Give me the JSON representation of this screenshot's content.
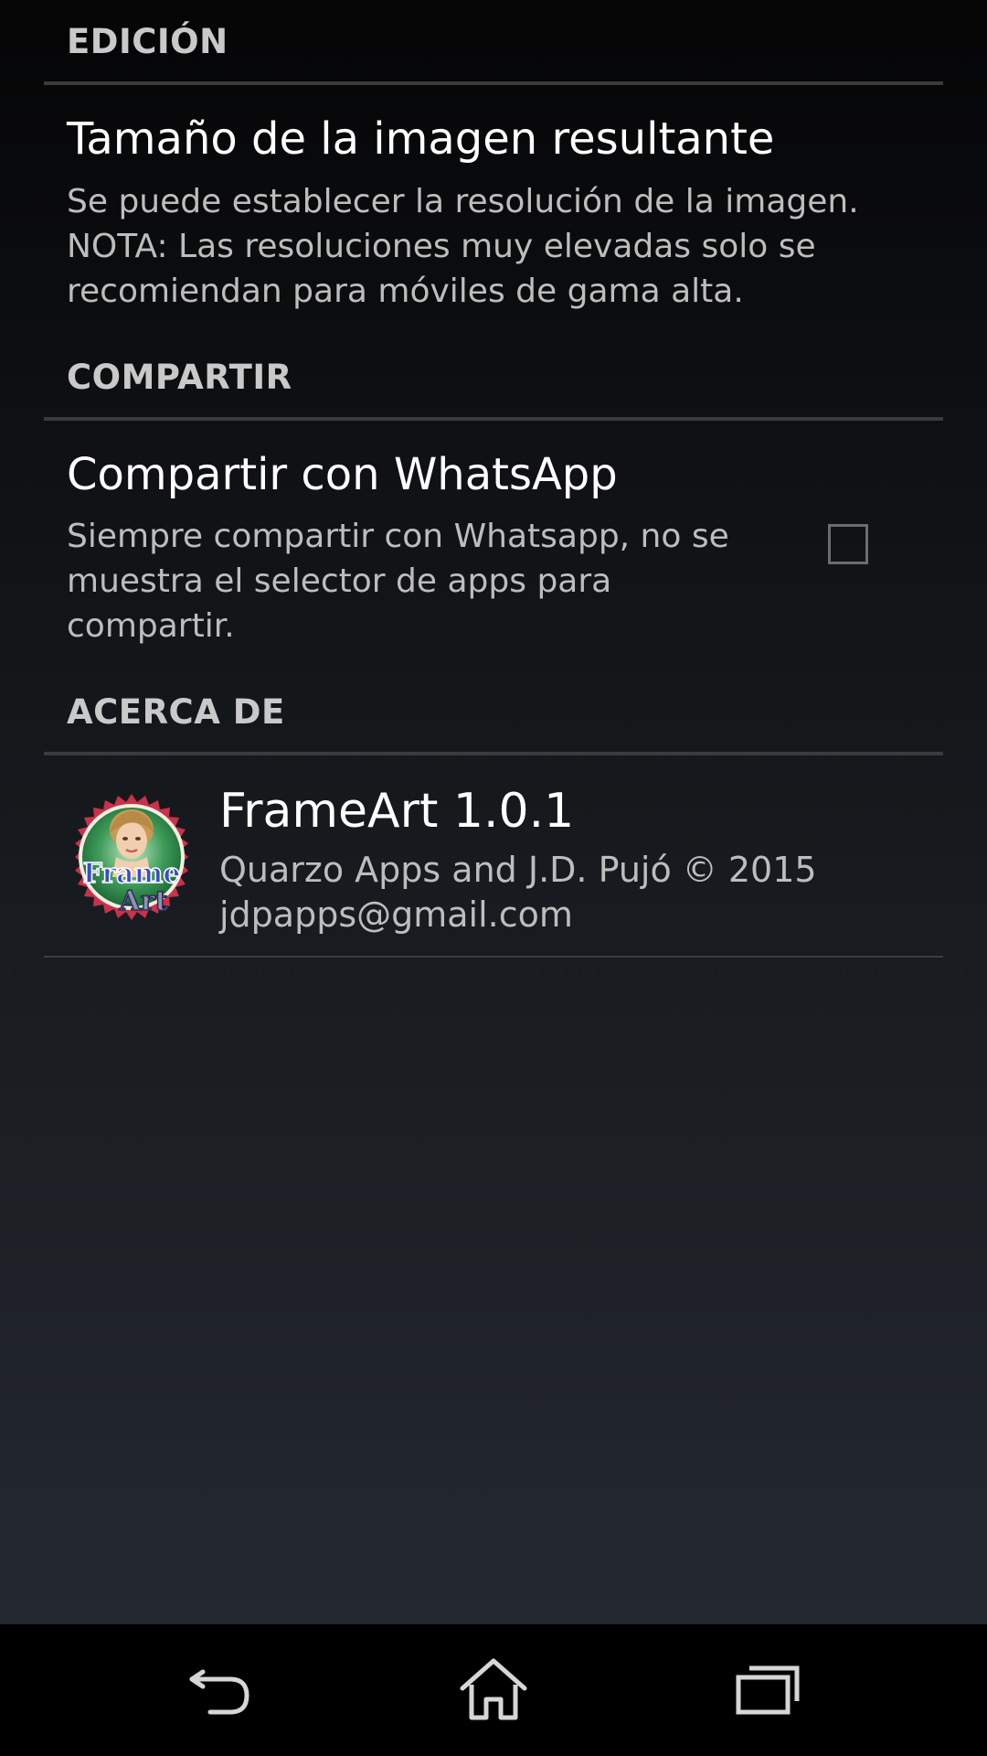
{
  "sections": {
    "edicion": {
      "header": "EDICIÓN",
      "title": "Tamaño de la imagen resultante",
      "summary_lines": [
        "Se puede establecer la resolución de la imagen.",
        "NOTA: Las resoluciones muy elevadas solo se",
        "recomiendan para móviles de gama alta."
      ]
    },
    "compartir": {
      "header": "COMPARTIR",
      "title": "Compartir con WhatsApp",
      "summary_lines": [
        "Siempre compartir con Whatsapp, no se",
        "muestra el selector de apps para",
        "compartir."
      ],
      "checked": false
    },
    "acerca": {
      "header": "ACERCA DE",
      "title": "FrameArt 1.0.1",
      "summary_lines": [
        "Quarzo Apps and J.D. Pujó © 2015",
        "jdpapps@gmail.com"
      ],
      "icon_text": [
        "Frame",
        "Art"
      ]
    }
  },
  "navbar": {
    "icons": [
      "back-icon",
      "home-icon",
      "recent-apps-icon"
    ]
  },
  "colors": {
    "header_text": "#c9c9c9",
    "summary_text": "#bdbdbd",
    "icon_green": "#2e8b57",
    "icon_text_blue": "#3b4bc8"
  }
}
